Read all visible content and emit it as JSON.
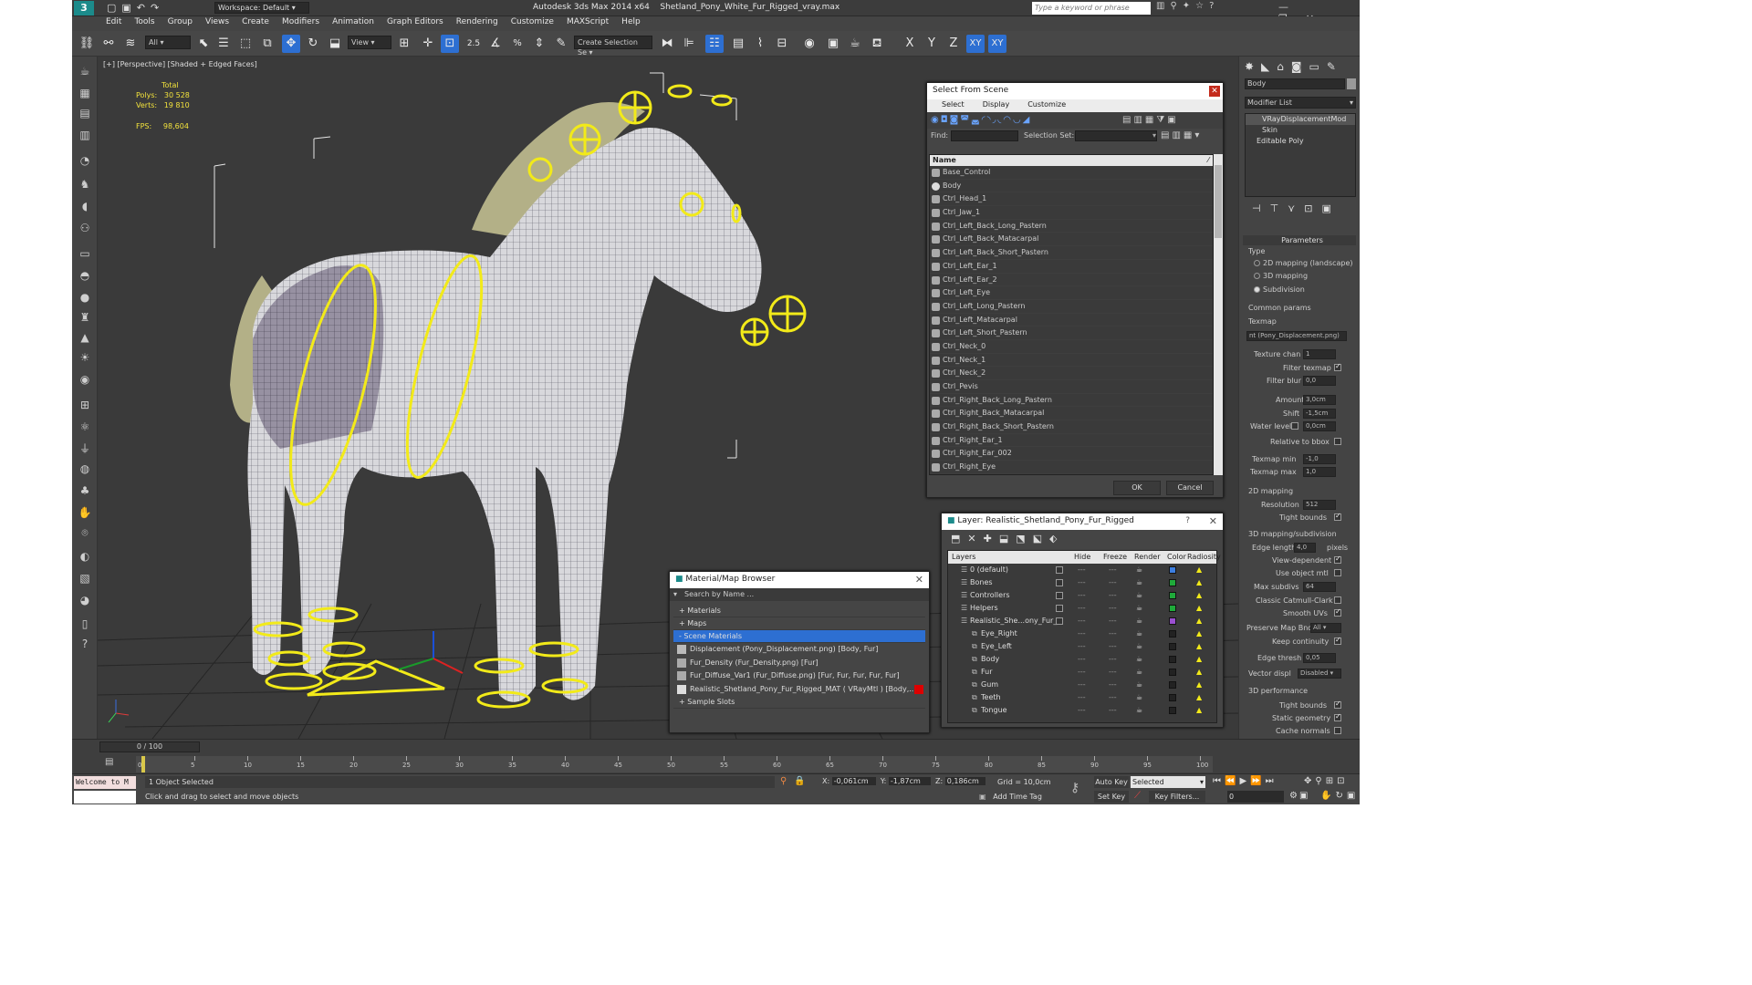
{
  "title": {
    "workspace": "Workspace: Default",
    "app": "Autodesk 3ds Max  2014 x64",
    "file": "Shetland_Pony_White_Fur_Rigged_vray.max",
    "search_placeholder": "Type a keyword or phrase"
  },
  "menu": [
    "Edit",
    "Tools",
    "Group",
    "Views",
    "Create",
    "Modifiers",
    "Animation",
    "Graph Editors",
    "Rendering",
    "Customize",
    "MAXScript",
    "Help"
  ],
  "toolbar": {
    "filter": "All",
    "ref_coord": "View",
    "snap_label": "2.5",
    "selection_set_placeholder": "Create Selection Se",
    "axes": [
      "X",
      "Y",
      "Z",
      "XY",
      "XY"
    ]
  },
  "viewport": {
    "label": "[+] [Perspective] [Shaded + Edged Faces]",
    "stats": {
      "total_label": "Total",
      "polys_label": "Polys:",
      "polys": "30 528",
      "verts_label": "Verts:",
      "verts": "19 810",
      "fps_label": "FPS:",
      "fps": "98,604"
    }
  },
  "select_from_scene": {
    "title": "Select From Scene",
    "tabs": [
      "Select",
      "Display",
      "Customize"
    ],
    "find_label": "Find:",
    "selset_label": "Selection Set:",
    "col_name": "Name",
    "items": [
      "Base_Control",
      "Body",
      "Ctrl_Head_1",
      "Ctrl_Jaw_1",
      "Ctrl_Left_Back_Long_Pastern",
      "Ctrl_Left_Back_Matacarpal",
      "Ctrl_Left_Back_Short_Pastern",
      "Ctrl_Left_Ear_1",
      "Ctrl_Left_Ear_2",
      "Ctrl_Left_Eye",
      "Ctrl_Left_Long_Pastern",
      "Ctrl_Left_Matacarpal",
      "Ctrl_Left_Short_Pastern",
      "Ctrl_Neck_0",
      "Ctrl_Neck_1",
      "Ctrl_Neck_2",
      "Ctrl_Pevis",
      "Ctrl_Right_Back_Long_Pastern",
      "Ctrl_Right_Back_Matacarpal",
      "Ctrl_Right_Back_Short_Pastern",
      "Ctrl_Right_Ear_1",
      "Ctrl_Right_Ear_002",
      "Ctrl_Right_Eye"
    ],
    "ok": "OK",
    "cancel": "Cancel"
  },
  "layer_dialog": {
    "title": "Layer: Realistic_Shetland_Pony_Fur_Rigged",
    "help": "?",
    "cols": [
      "Layers",
      "Hide",
      "Freeze",
      "Render",
      "Color",
      "Radiosity"
    ],
    "rows": [
      {
        "name": "0 (default)",
        "indent": 0,
        "color": "#3c7ee0"
      },
      {
        "name": "Bones",
        "indent": 0,
        "color": "#1faa3a"
      },
      {
        "name": "Controllers",
        "indent": 0,
        "color": "#1faa3a"
      },
      {
        "name": "Helpers",
        "indent": 0,
        "color": "#1faa3a"
      },
      {
        "name": "Realistic_She...ony_Fur_F",
        "indent": 0,
        "color": "#9a4fd0"
      },
      {
        "name": "Eye_Right",
        "indent": 1,
        "color": "#222222"
      },
      {
        "name": "Eye_Left",
        "indent": 1,
        "color": "#222222"
      },
      {
        "name": "Body",
        "indent": 1,
        "color": "#222222"
      },
      {
        "name": "Fur",
        "indent": 1,
        "color": "#222222"
      },
      {
        "name": "Gum",
        "indent": 1,
        "color": "#222222"
      },
      {
        "name": "Teeth",
        "indent": 1,
        "color": "#222222"
      },
      {
        "name": "Tongue",
        "indent": 1,
        "color": "#222222"
      }
    ]
  },
  "material_browser": {
    "title": "Material/Map Browser",
    "search_placeholder": "Search by Name ...",
    "groups": [
      "+ Materials",
      "+ Maps",
      "- Scene Materials",
      "+ Sample Slots"
    ],
    "materials": [
      "Displacement (Pony_Displacement.png) [Body, Fur]",
      "Fur_Density (Fur_Density.png) [Fur]",
      "Fur_Diffuse_Var1 (Fur_Diffuse.png) [Fur, Fur, Fur, Fur, Fur]",
      "Realistic_Shetland_Pony_Fur_Rigged_MAT ( VRayMtl ) [Body,..."
    ]
  },
  "command_panel": {
    "object_name": "Body",
    "modifier_list": "Modifier List",
    "stack": [
      "VRayDisplacementMod",
      "Skin",
      "Editable Poly"
    ],
    "parameters": "Parameters",
    "type_label": "Type",
    "type_options": [
      "2D mapping (landscape)",
      "3D mapping",
      "Subdivision"
    ],
    "common_params": "Common params",
    "texmap_label": "Texmap",
    "texmap_value": "nt (Pony_Displacement.png)",
    "texture_chan_label": "Texture chan",
    "texture_chan": "1",
    "filter_texmap": "Filter texmap",
    "filter_blur_label": "Filter blur",
    "filter_blur": "0,0",
    "amount_label": "Amount",
    "amount": "3,0cm",
    "shift_label": "Shift",
    "shift": "-1,5cm",
    "water_level_label": "Water level",
    "water_level": "0,0cm",
    "relative_bbox": "Relative to bbox",
    "texmap_min_label": "Texmap min",
    "texmap_min": "-1,0",
    "texmap_max_label": "Texmap max",
    "texmap_max": "1,0",
    "mapping2d": "2D mapping",
    "resolution_label": "Resolution",
    "resolution": "512",
    "tight_bounds": "Tight bounds",
    "mapping3d": "3D mapping/subdivision",
    "edge_length_label": "Edge length",
    "edge_length": "4,0",
    "pixels": "pixels",
    "view_dependent": "View-dependent",
    "use_object_mtl": "Use object mtl",
    "max_subdivs_label": "Max subdivs",
    "max_subdivs": "64",
    "classic_catmull": "Classic Catmull-Clark",
    "smooth_uvs": "Smooth UVs",
    "preserve_map_label": "Preserve Map Bnd",
    "preserve_map": "All",
    "keep_continuity": "Keep continuity",
    "edge_thresh_label": "Edge thresh",
    "edge_thresh": "0,05",
    "vector_displ_label": "Vector displ",
    "vector_displ": "Disabled",
    "perf": "3D performance",
    "tight_bounds2": "Tight bounds",
    "static_geometry": "Static geometry",
    "cache_normals": "Cache normals"
  },
  "timeline": {
    "frame": "0 / 100",
    "ticks": [
      "0",
      "5",
      "10",
      "15",
      "20",
      "25",
      "30",
      "35",
      "40",
      "45",
      "50",
      "55",
      "60",
      "65",
      "70",
      "75",
      "80",
      "85",
      "90",
      "95",
      "100"
    ]
  },
  "status": {
    "maxscript": "Welcome to M",
    "selected": "1 Object Selected",
    "prompt": "Click and drag to select and move objects",
    "x_label": "X:",
    "x": "-0,061cm",
    "y_label": "Y:",
    "y": "-1,87cm",
    "z_label": "Z:",
    "z": "0,186cm",
    "grid": "Grid = 10,0cm",
    "auto_key": "Auto Key",
    "selected_dd": "Selected",
    "set_key": "Set Key",
    "key_filters": "Key Filters...",
    "add_time_tag": "Add Time Tag",
    "frame_field": "0"
  }
}
